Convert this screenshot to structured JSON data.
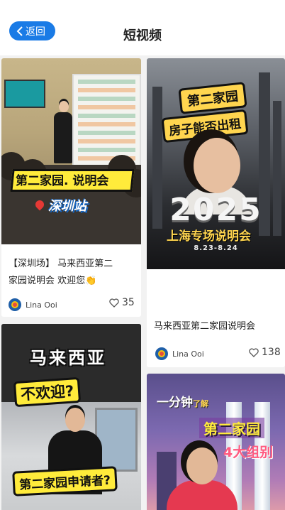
{
  "header": {
    "back_label": "返回",
    "title": "短视频"
  },
  "thumbs": {
    "t1_band": "第二家园. 说明会",
    "t1_sub": "深圳站",
    "t2_tag1": "第二家园",
    "t2_tag2": "房子能否出租",
    "t2_year": "2025",
    "t2_line1": "上海专场说明会",
    "t2_dates": "8.23-8.24",
    "t3_q1": "马来西亚",
    "t3_q2": "不欢迎?",
    "t3_bottom": "第二家园申请者?",
    "t4_top_a": "一分钟",
    "t4_top_b": "了解",
    "t4_mid": "第二家园",
    "t4_low": "4大组别"
  },
  "cards": [
    {
      "caption_line1": "【深圳场】 马来西亚第二",
      "caption_line2": "家园说明会 欢迎您👏",
      "author": "Lina Ooi",
      "likes": "35"
    },
    {
      "caption_line1": "马来西亚第二家园说明会",
      "author": "Lina Ooi",
      "likes": "138"
    }
  ],
  "colors": {
    "accent": "#1a7be6",
    "page_bg": "#f2f2f2",
    "highlight": "#ffeb3b"
  },
  "icons": {
    "back": "chevron-left-icon",
    "like": "heart-outline-icon",
    "avatar": "malaysia-seal-avatar"
  }
}
